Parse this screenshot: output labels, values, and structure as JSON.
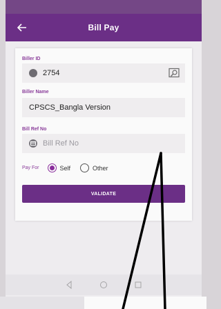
{
  "status_bar": {
    "left_text": "",
    "right_text": ""
  },
  "app_bar": {
    "title": "Bill Pay",
    "back_icon": "arrow-left-icon"
  },
  "form": {
    "biller_id": {
      "label": "Biller ID",
      "value": "2754",
      "icon": "id-icon",
      "lookup_icon": "search-icon"
    },
    "biller_name": {
      "label": "Biller Name",
      "value": "CPSCS_Bangla Version"
    },
    "bill_ref": {
      "label": "Bill Ref No",
      "placeholder": "Bill Ref No",
      "value": "",
      "icon": "card-icon"
    },
    "pay_for": {
      "label": "Pay For",
      "options": [
        {
          "label": "Self",
          "selected": true
        },
        {
          "label": "Other",
          "selected": false
        }
      ]
    },
    "validate_label": "VALIDATE"
  },
  "colors": {
    "primary": "#6b2f86",
    "accent": "#8a2d9c",
    "field_bg": "#efedef"
  }
}
